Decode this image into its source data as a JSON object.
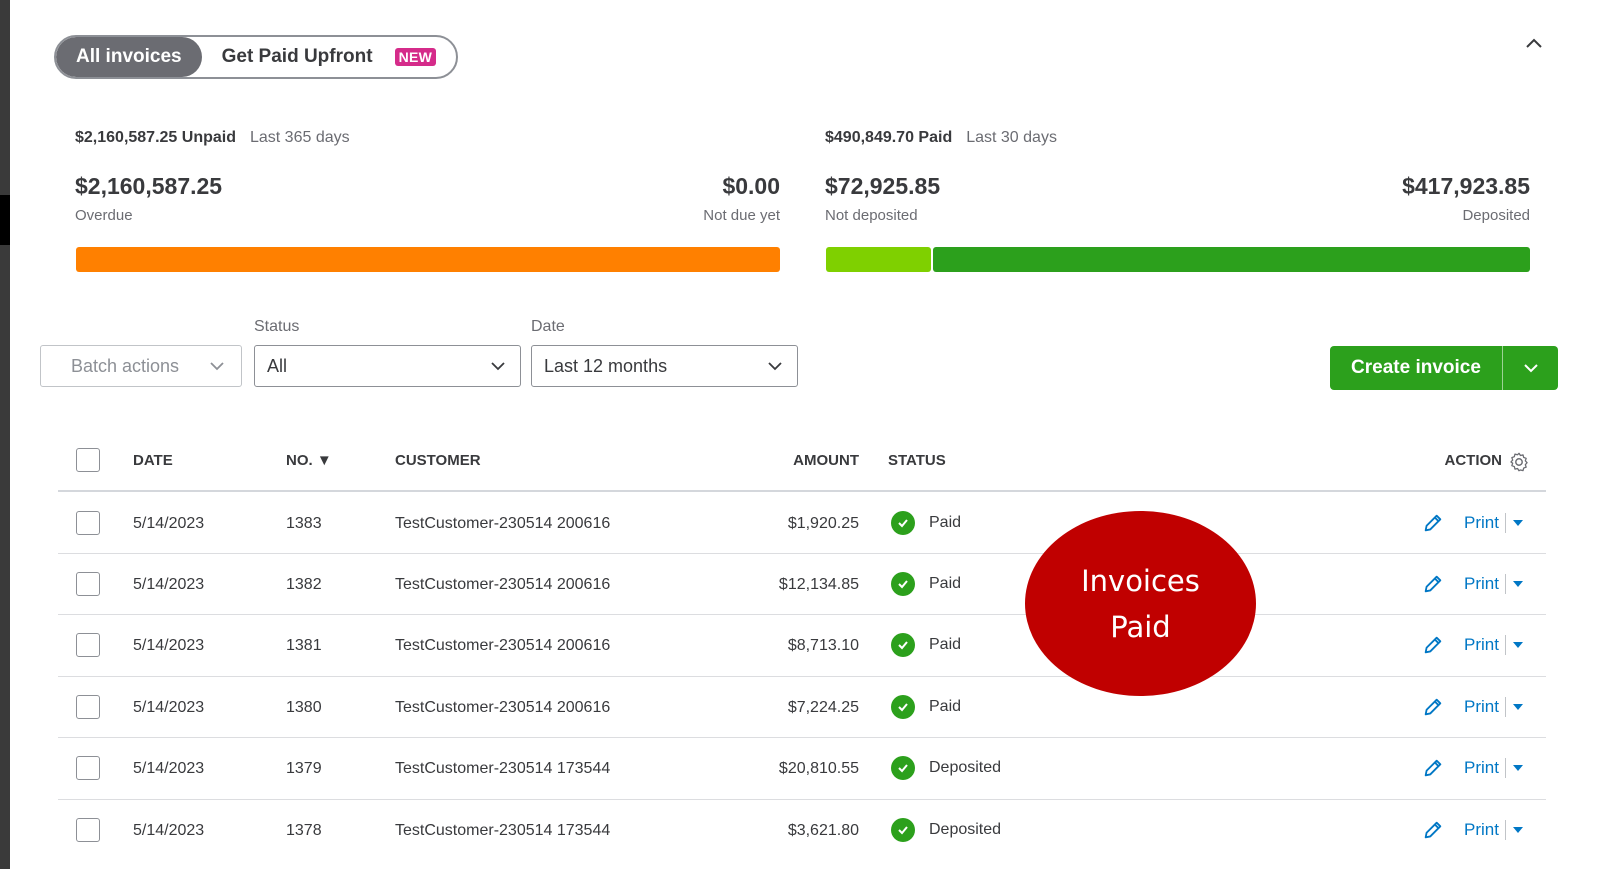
{
  "tabs": {
    "all_invoices": "All invoices",
    "get_paid_upfront": "Get Paid Upfront",
    "new_badge": "NEW"
  },
  "summary": {
    "unpaid": {
      "total_label": "$2,160,587.25 Unpaid",
      "period": "Last 365 days",
      "overdue_amount": "$2,160,587.25",
      "overdue_label": "Overdue",
      "not_due_amount": "$0.00",
      "not_due_label": "Not due yet",
      "overdue_fraction": 1.0,
      "overdue_color": "#ff8000"
    },
    "paid": {
      "total_label": "$490,849.70 Paid",
      "period": "Last 30 days",
      "not_deposited_amount": "$72,925.85",
      "not_deposited_label": "Not deposited",
      "deposited_amount": "$417,923.85",
      "deposited_label": "Deposited",
      "not_deposited_fraction": 0.1486,
      "not_deposited_color": "#7fd000",
      "deposited_color": "#2ca01c"
    }
  },
  "filters": {
    "batch_actions": "Batch actions",
    "status_label": "Status",
    "status_value": "All",
    "date_label": "Date",
    "date_value": "Last 12 months"
  },
  "create_invoice": "Create invoice",
  "table": {
    "headers": {
      "date": "DATE",
      "no": "NO. ▼",
      "customer": "CUSTOMER",
      "amount": "AMOUNT",
      "status": "STATUS",
      "action": "ACTION"
    },
    "rows": [
      {
        "date": "5/14/2023",
        "no": "1383",
        "customer": "TestCustomer-230514 200616",
        "amount": "$1,920.25",
        "status": "Paid",
        "action": "Print"
      },
      {
        "date": "5/14/2023",
        "no": "1382",
        "customer": "TestCustomer-230514 200616",
        "amount": "$12,134.85",
        "status": "Paid",
        "action": "Print"
      },
      {
        "date": "5/14/2023",
        "no": "1381",
        "customer": "TestCustomer-230514 200616",
        "amount": "$8,713.10",
        "status": "Paid",
        "action": "Print"
      },
      {
        "date": "5/14/2023",
        "no": "1380",
        "customer": "TestCustomer-230514 200616",
        "amount": "$7,224.25",
        "status": "Paid",
        "action": "Print"
      },
      {
        "date": "5/14/2023",
        "no": "1379",
        "customer": "TestCustomer-230514 173544",
        "amount": "$20,810.55",
        "status": "Deposited",
        "action": "Print"
      },
      {
        "date": "5/14/2023",
        "no": "1378",
        "customer": "TestCustomer-230514 173544",
        "amount": "$3,621.80",
        "status": "Deposited",
        "action": "Print"
      }
    ]
  },
  "annotation": {
    "line1": "Invoices",
    "line2": "Paid",
    "color": "#c00000"
  }
}
